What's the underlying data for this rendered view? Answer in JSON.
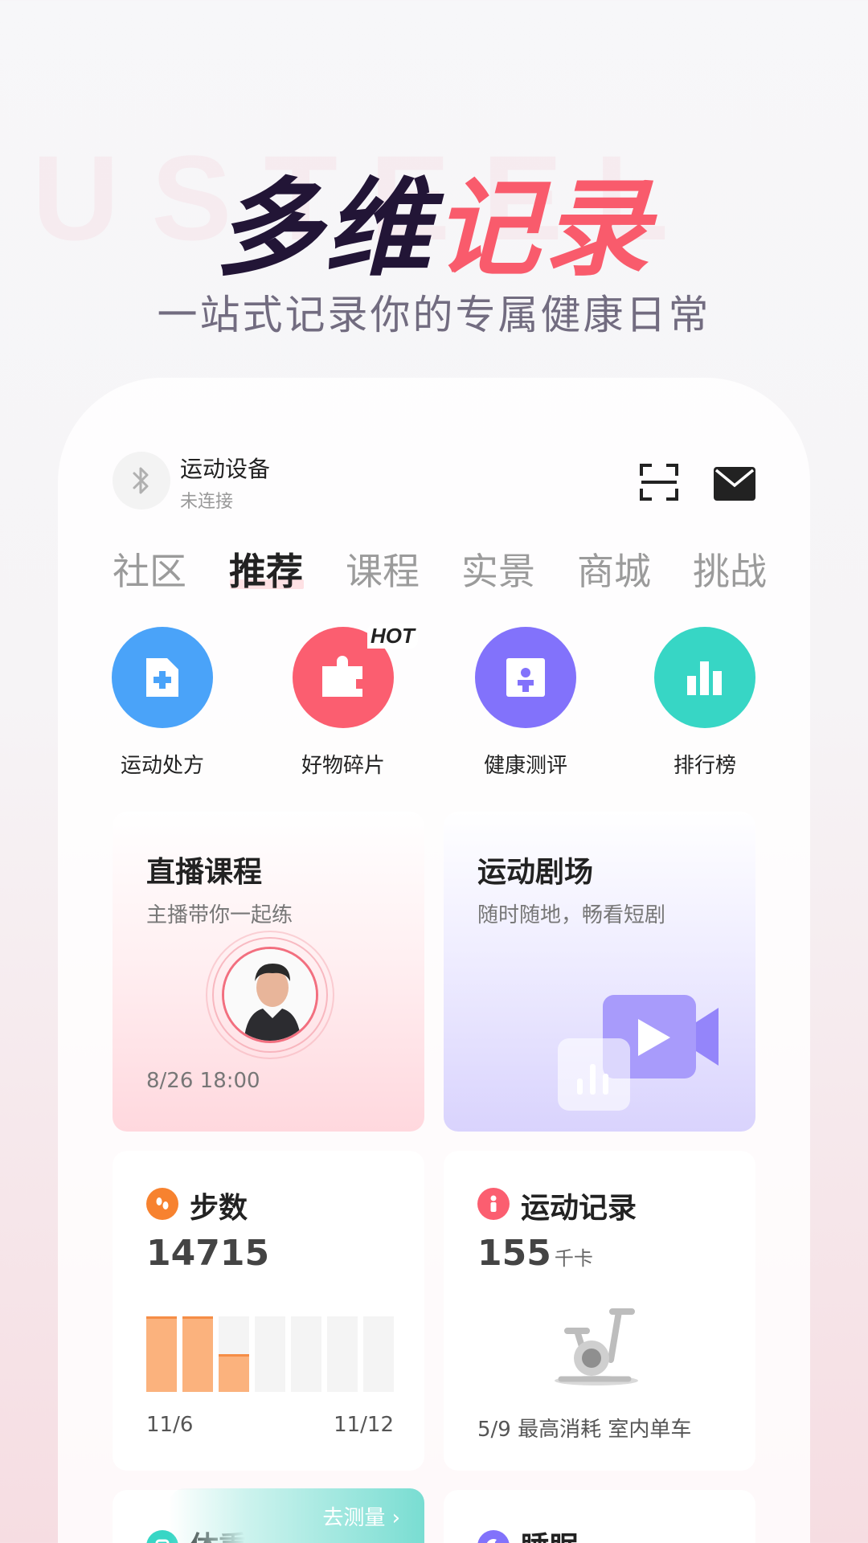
{
  "hero": {
    "bg_text": "USTEEL",
    "title_dark": "多维",
    "title_red": "记录",
    "subtitle": "一站式记录你的专属健康日常"
  },
  "device": {
    "title": "运动设备",
    "status": "未连接"
  },
  "tabs": [
    "社区",
    "推荐",
    "课程",
    "实景",
    "商城",
    "挑战"
  ],
  "active_tab": "推荐",
  "quick_actions": [
    {
      "label": "运动处方",
      "color": "#4aa3f9",
      "icon": "file-plus-icon"
    },
    {
      "label": "好物碎片",
      "color": "#fb5e70",
      "icon": "puzzle-icon",
      "badge": "HOT"
    },
    {
      "label": "健康测评",
      "color": "#8272fb",
      "icon": "person-card-icon"
    },
    {
      "label": "排行榜",
      "color": "#37d6c5",
      "icon": "bar-chart-icon"
    }
  ],
  "live": {
    "title": "直播课程",
    "subtitle": "主播带你一起练",
    "time": "8/26 18:00"
  },
  "theater": {
    "title": "运动剧场",
    "subtitle": "随时随地，畅看短剧"
  },
  "steps": {
    "title": "步数",
    "value": "14715",
    "levels": [
      1.0,
      1.0,
      0.5,
      0,
      0,
      0,
      0
    ],
    "date_start": "11/6",
    "date_end": "11/12"
  },
  "record": {
    "title": "运动记录",
    "value": "155",
    "unit": "千卡",
    "footer": "5/9 最高消耗 室内单车"
  },
  "weight": {
    "title": "体重",
    "measure_label": "去测量 ›"
  },
  "sleep": {
    "title": "睡眠"
  },
  "colors": {
    "accent": "#f95b6c",
    "steps_bar": "#fbb27d",
    "steps_icon": "#f7822f",
    "record_icon": "#fb5e70",
    "weight_icon": "#37d6c5",
    "sleep_icon": "#8272fb"
  }
}
